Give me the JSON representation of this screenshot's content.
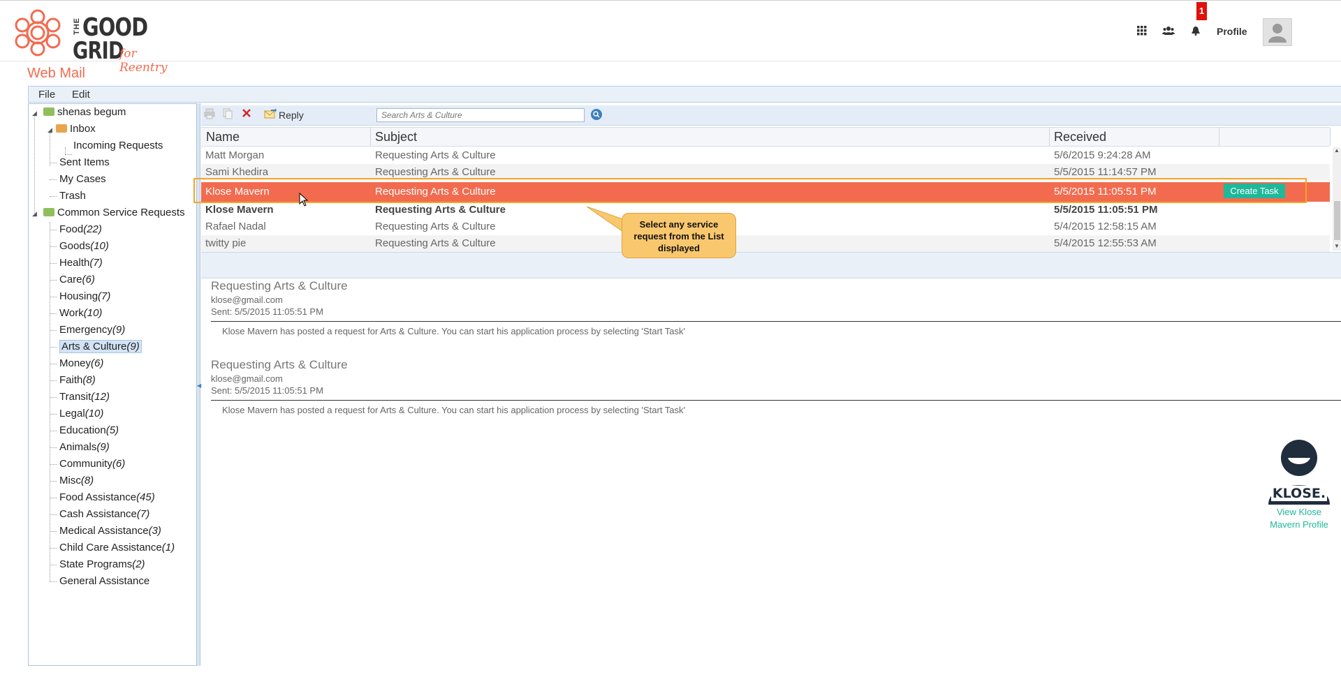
{
  "brand": {
    "the": "THE",
    "good": "GOOD",
    "grid": "GRID",
    "tagline": "for Reentry"
  },
  "header": {
    "notification_count": "1",
    "profile_label": "Profile"
  },
  "page_title": "Web Mail",
  "menu": {
    "file": "File",
    "edit": "Edit"
  },
  "sidebar": {
    "user": "shenas begum",
    "inbox": "Inbox",
    "incoming": "Incoming Requests",
    "sent": "Sent Items",
    "cases": "My Cases",
    "trash": "Trash",
    "common": "Common Service Requests",
    "categories": [
      {
        "name": "Food",
        "count": "(22)"
      },
      {
        "name": "Goods",
        "count": "(10)"
      },
      {
        "name": "Health",
        "count": "(7)"
      },
      {
        "name": "Care",
        "count": "(6)"
      },
      {
        "name": "Housing",
        "count": "(7)"
      },
      {
        "name": "Work",
        "count": "(10)"
      },
      {
        "name": "Emergency",
        "count": "(9)"
      },
      {
        "name": "Arts & Culture",
        "count": "(9)"
      },
      {
        "name": "Money",
        "count": "(6)"
      },
      {
        "name": "Faith",
        "count": "(8)"
      },
      {
        "name": "Transit",
        "count": "(12)"
      },
      {
        "name": "Legal",
        "count": "(10)"
      },
      {
        "name": "Education",
        "count": "(5)"
      },
      {
        "name": "Animals",
        "count": "(9)"
      },
      {
        "name": "Community",
        "count": "(6)"
      },
      {
        "name": "Misc",
        "count": "(8)"
      },
      {
        "name": "Food Assistance",
        "count": "(45)"
      },
      {
        "name": "Cash Assistance",
        "count": "(7)"
      },
      {
        "name": "Medical Assistance",
        "count": "(3)"
      },
      {
        "name": "Child Care Assistance",
        "count": "(1)"
      },
      {
        "name": "State Programs",
        "count": "(2)"
      },
      {
        "name": "General Assistance",
        "count": ""
      }
    ]
  },
  "toolbar": {
    "reply_label": "Reply",
    "search_placeholder": "Search Arts & Culture"
  },
  "grid": {
    "columns": {
      "name": "Name",
      "subject": "Subject",
      "received": "Received"
    },
    "rows": [
      {
        "name": "Matt Morgan",
        "subject": "Requesting Arts & Culture",
        "received": "5/6/2015 9:24:28 AM"
      },
      {
        "name": "Sami Khedira",
        "subject": "Requesting Arts & Culture",
        "received": "5/5/2015 11:14:57 PM"
      },
      {
        "name": "Klose Mavern",
        "subject": "Requesting Arts & Culture",
        "received": "5/5/2015 11:05:51 PM",
        "action": "Create Task"
      },
      {
        "name": "Klose Mavern",
        "subject": "Requesting Arts & Culture",
        "received": "5/5/2015 11:05:51 PM"
      },
      {
        "name": "Rafael Nadal",
        "subject": "Requesting Arts & Culture",
        "received": "5/4/2015 12:58:15 AM"
      },
      {
        "name": "twitty pie",
        "subject": "Requesting Arts & Culture",
        "received": "5/4/2015 12:55:53 AM"
      }
    ]
  },
  "callout": "Select any service request from the List displayed",
  "messages": [
    {
      "subject": "Requesting Arts & Culture",
      "email": "klose@gmail.com",
      "sent": "Sent: 5/5/2015 11:05:51 PM",
      "body": "Klose Mavern has posted a request for Arts & Culture. You can start his application process by selecting 'Start Task'"
    },
    {
      "subject": "Requesting Arts & Culture",
      "email": "klose@gmail.com",
      "sent": "Sent: 5/5/2015 11:05:51 PM",
      "body": "Klose Mavern has posted a request for Arts & Culture. You can start his application process by selecting 'Start Task'"
    }
  ],
  "profile_card": {
    "badge": "KLOSE.",
    "link": "View Klose Mavern Profile"
  },
  "colors": {
    "accent": "#f26b4f",
    "teal": "#1fb89a",
    "highlight": "#f5a623",
    "badge": "#e0100d"
  },
  "icons": [
    "apps-grid-icon",
    "users-icon",
    "bell-icon",
    "print-icon",
    "copy-icon",
    "delete-icon",
    "reply-icon",
    "search-icon",
    "folder-icon",
    "mouse-cursor-icon"
  ]
}
